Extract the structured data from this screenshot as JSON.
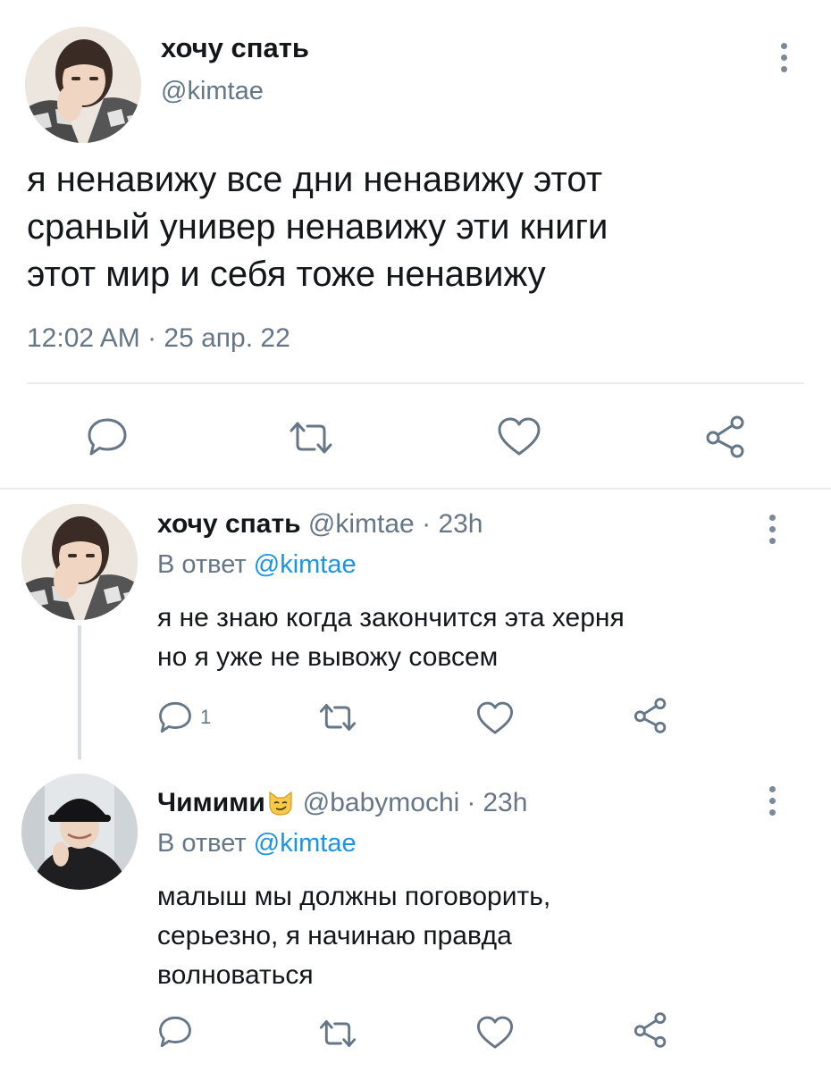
{
  "main_tweet": {
    "display_name": "хочу спать",
    "handle": "@kimtae",
    "text_lines": [
      "я ненавижу все дни ненавижу этот",
      "сраный универ ненавижу эти книги",
      "этот мир и себя тоже ненавижу"
    ],
    "timestamp": "12:02 AM · 25 апр. 22"
  },
  "replies": [
    {
      "display_name": "хочу спать",
      "handle": "@kimtae",
      "sep": "·",
      "time": "23h",
      "reply_prefix": "В ответ",
      "reply_to": "@kimtae",
      "text_lines": [
        "я не знаю когда закончится эта херня",
        "но я уже не вывожу совсем"
      ],
      "reply_count": "1"
    },
    {
      "display_name": "Чимими",
      "handle": "@babymochi",
      "sep": "·",
      "time": "23h",
      "reply_prefix": "В ответ",
      "reply_to": "@kimtae",
      "text_lines": [
        "малыш мы должны поговорить,",
        "серьезно, я начинаю правда",
        "волноваться"
      ]
    }
  ],
  "icons": {
    "reply": "reply-icon",
    "retweet": "retweet-icon",
    "like": "heart-icon",
    "share": "share-icon",
    "more": "more-vertical-icon",
    "emoji": "smirking-cat-emoji"
  },
  "colors": {
    "text": "#14171a",
    "muted": "#657786",
    "link": "#1b95e0",
    "divider": "#e6ecf0"
  }
}
